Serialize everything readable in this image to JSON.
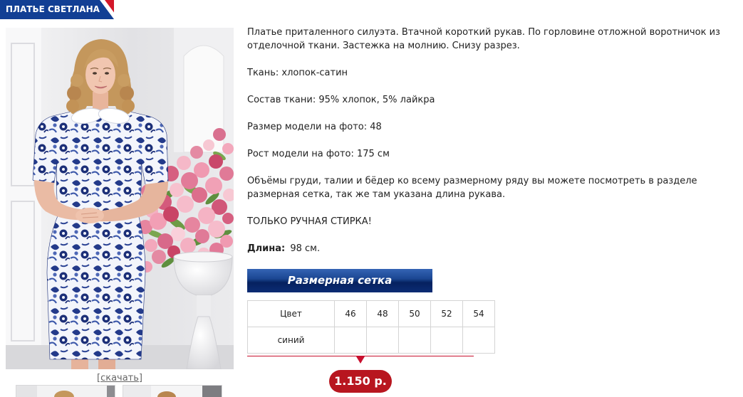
{
  "header": {
    "title": "ПЛАТЬЕ СВЕТЛАНА"
  },
  "gallery": {
    "download_label": "[скачать]"
  },
  "description": {
    "intro": "Платье приталенного силуэта. Втачной короткий рукав. По горловине отложной воротничок из отделочной ткани. Застежка на молнию. Снизу разрез.",
    "fabric": "Ткань: хлопок-сатин",
    "composition": "Состав ткани: 95% хлопок, 5% лайкра",
    "model_size": "Размер модели на фото: 48",
    "model_height": "Рост модели на фото: 175 см",
    "size_note": "Объёмы груди, талии и бёдер ко всему размерному ряду вы можете посмотреть в разделе размерная сетка, так же там указана длина рукава.",
    "care": "ТОЛЬКО РУЧНАЯ СТИРКА!",
    "length_label": "Длина:",
    "length_value": "98 см."
  },
  "size_chart": {
    "button_label": "Размерная сетка",
    "headers": [
      "Цвет",
      "46",
      "48",
      "50",
      "52",
      "54"
    ],
    "rows": [
      {
        "color": "синий",
        "cells": [
          "",
          "",
          "",
          "",
          ""
        ]
      }
    ]
  },
  "price": {
    "label": "1.150 р."
  },
  "colors": {
    "banner_blue": "#123f94",
    "banner_red": "#d3182a",
    "button_top": "#3464b4",
    "button_bottom": "#06215f",
    "divider_red": "#c8102e",
    "price_red": "#b8161f",
    "link_gray": "#666666"
  }
}
